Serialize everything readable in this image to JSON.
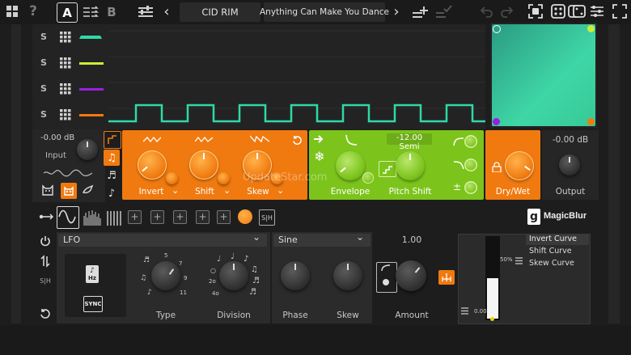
{
  "toolbar": {
    "preset_a": "A",
    "preset_b": "B",
    "help": "?",
    "prev_arrow": "‹",
    "next_arrow": "›",
    "preset_bank": "CID RIM",
    "preset_name": "Anything Can Make You Dance"
  },
  "sequencer": {
    "rows": [
      {
        "label": "S",
        "color": "#2fd9a8"
      },
      {
        "label": "S",
        "color": "#c9ee3a"
      },
      {
        "label": "S",
        "color": "#9a1fe0"
      },
      {
        "label": "S",
        "color": "#f07a10"
      }
    ]
  },
  "input": {
    "gain": "-0.00 dB",
    "label": "Input"
  },
  "modifier": {
    "knobs": [
      {
        "label": "Invert"
      },
      {
        "label": "Shift"
      },
      {
        "label": "Skew"
      }
    ]
  },
  "envelope": {
    "value": "-12.00 Semi",
    "env_label": "Envelope",
    "pitch_label": "Pitch Shift"
  },
  "drywet": {
    "label": "Dry/Wet"
  },
  "output": {
    "gain": "-0.00 dB",
    "label": "Output"
  },
  "brand": {
    "name": "MagicBlur",
    "watermark": "UpdateStar.com"
  },
  "mod_bar": {
    "sh_label": "S|H"
  },
  "lfo": {
    "sh_side": "S|H",
    "source": "LFO",
    "shape": "Sine",
    "hz": "Hz",
    "sync": "SYNC",
    "type_label": "Type",
    "division_label": "Division",
    "type_marks": [
      "5",
      "7",
      "9",
      "11"
    ],
    "division_marks": [
      "2o",
      "4o"
    ],
    "phase_label": "Phase",
    "skew_label": "Skew",
    "amount_value": "1.00",
    "amount_label": "Amount"
  },
  "curves": {
    "items": [
      "Invert Curve",
      "Shift Curve",
      "Skew Curve"
    ],
    "pct": "50%",
    "val": "0.00"
  },
  "colors": {
    "orange": "#f07a10",
    "green": "#7cc41c",
    "teal": "#2fd9a8"
  }
}
